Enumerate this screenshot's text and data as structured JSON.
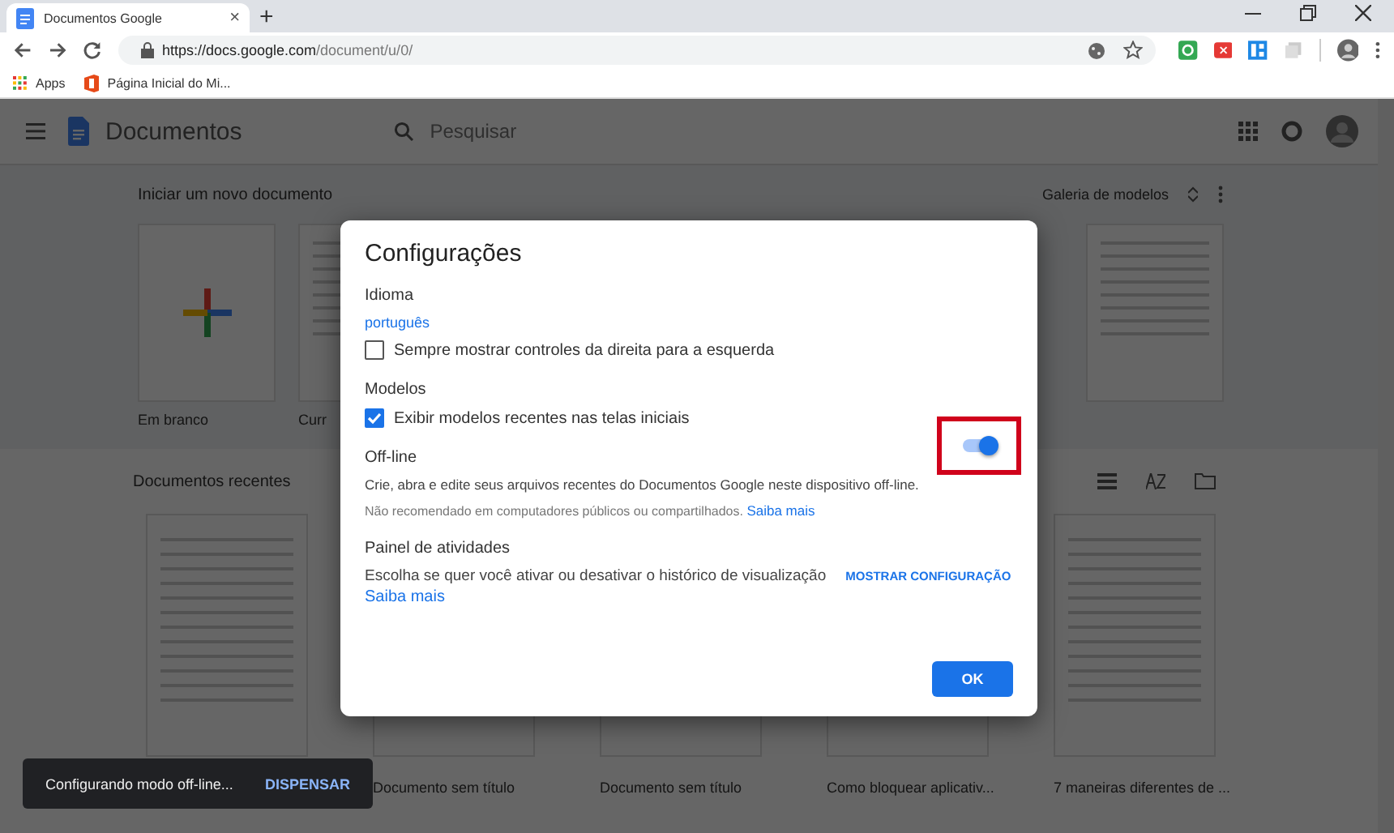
{
  "browser": {
    "tab": {
      "title": "Documentos Google",
      "close": "×",
      "selected": true
    },
    "new_tab": "+",
    "url_host": "https://docs.google.com",
    "url_path": "/document/u/0/",
    "bookmarks": [
      {
        "kind": "apps",
        "label": "Apps"
      },
      {
        "kind": "office",
        "label": "Página Inicial do Mi..."
      }
    ]
  },
  "app_header": {
    "title": "Documentos",
    "search": {
      "placeholder": "Pesquisar"
    }
  },
  "templates": {
    "heading": "Iniciar um novo documento",
    "gallery": "Galeria de modelos",
    "cards": [
      {
        "kind": "blank",
        "label": "Em branco"
      },
      {
        "kind": "doc",
        "label": "Curr"
      },
      {
        "kind": "doc"
      }
    ]
  },
  "recent": {
    "heading": "Documentos recentes",
    "docs": [
      {
        "kind": "doc"
      },
      {
        "kind": "doc",
        "title": "Documento sem título"
      },
      {
        "kind": "doc",
        "title": "Documento sem título"
      },
      {
        "kind": "doc",
        "title": "Como bloquear aplicativ..."
      },
      {
        "kind": "doc",
        "title": "7 maneiras diferentes de ..."
      }
    ]
  },
  "dialog": {
    "title": "Configurações",
    "sections": [
      {
        "heading": "Idioma",
        "link": "português",
        "checkbox": {
          "label": "Sempre mostrar controles da direita para a esquerda",
          "checked": false
        }
      },
      {
        "heading": "Modelos",
        "checkbox": {
          "label": "Exibir modelos recentes nas telas iniciais",
          "checked": true
        }
      },
      {
        "heading": "Off-line",
        "description": "Crie, abra e edite seus arquivos recentes do Documentos Google neste dispositivo off-line.",
        "note": "Não recomendado em computadores públicos ou compartilhados.",
        "note_link": "Saiba mais",
        "toggle": {
          "on": true,
          "highlighted": true
        }
      },
      {
        "heading": "Painel de atividades",
        "description": "Escolha se quer você ativar ou desativar o histórico de visualização",
        "action": "MOSTRAR CONFIGURAÇÃO",
        "after_link": "Saiba mais"
      }
    ],
    "ok": "OK"
  },
  "snackbar": {
    "message": "Configurando modo off-line...",
    "action": "DISPENSAR"
  }
}
